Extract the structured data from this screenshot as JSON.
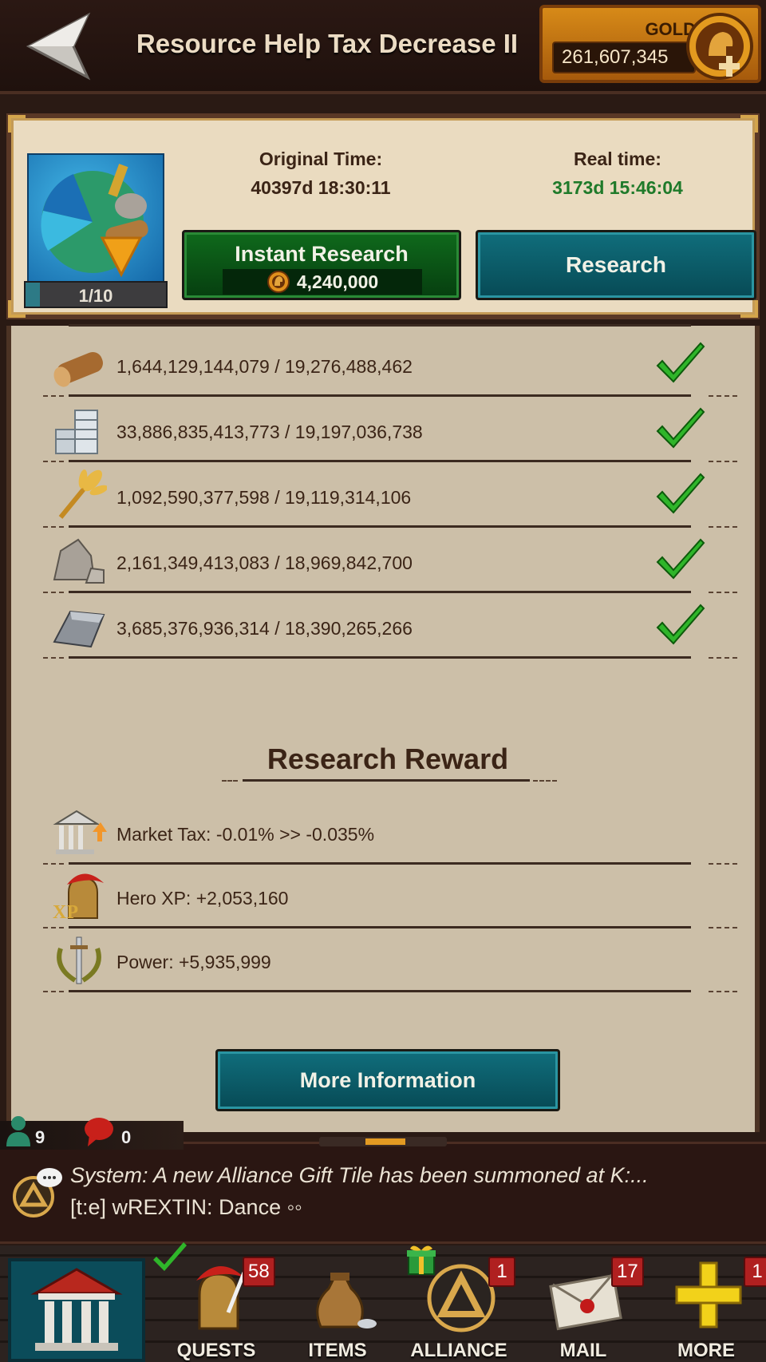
{
  "header": {
    "title": "Resource Help Tax Decrease II",
    "gold_label": "GOLD",
    "gold_value": "261,607,345"
  },
  "info": {
    "level": "1/10",
    "level_progress": 0.1,
    "original_time_label": "Original Time:",
    "original_time_value": "40397d 18:30:11",
    "real_time_label": "Real time:",
    "real_time_value": "3173d 15:46:04",
    "instant_label": "Instant Research",
    "instant_cost": "4,240,000",
    "research_label": "Research"
  },
  "requirements": [
    {
      "icon": "wood-icon",
      "text": "1,644,129,144,079 / 19,276,488,462",
      "met": true
    },
    {
      "icon": "silver-coins-icon",
      "text": "33,886,835,413,773 / 19,197,036,738",
      "met": true
    },
    {
      "icon": "food-wheat-icon",
      "text": "1,092,590,377,598 / 19,119,314,106",
      "met": true
    },
    {
      "icon": "stone-icon",
      "text": "2,161,349,413,083 / 18,969,842,700",
      "met": true
    },
    {
      "icon": "iron-ingot-icon",
      "text": "3,685,376,936,314 / 18,390,265,266",
      "met": true
    }
  ],
  "rewards": {
    "heading": "Research Reward",
    "items": [
      {
        "icon": "market-tax-icon",
        "text": "Market Tax: -0.01% >> -0.035%"
      },
      {
        "icon": "hero-xp-icon",
        "text": "Hero XP: +2,053,160"
      },
      {
        "icon": "power-icon",
        "text": "Power: +5,935,999"
      }
    ]
  },
  "more_info_label": "More Information",
  "status": {
    "online_count": "9",
    "messages_count": "0"
  },
  "chat": {
    "line1": "System: A new Alliance Gift Tile has been summoned at K:...",
    "line2": "[t:e] wREXTIN: Dance ◦◦"
  },
  "nav": {
    "quests": {
      "label": "QUESTS",
      "badge": "58"
    },
    "items": {
      "label": "ITEMS"
    },
    "alliance": {
      "label": "ALLIANCE",
      "badge": "1"
    },
    "mail": {
      "label": "MAIL",
      "badge": "17"
    },
    "more": {
      "label": "MORE",
      "badge": "1"
    }
  },
  "colors": {
    "real_time": "#1f7a2a",
    "check": "#2fb52a",
    "button_teal": "#0b5e6a",
    "button_green": "#0a5a17",
    "badge_red": "#b02020",
    "gold_orange": "#c77514"
  }
}
